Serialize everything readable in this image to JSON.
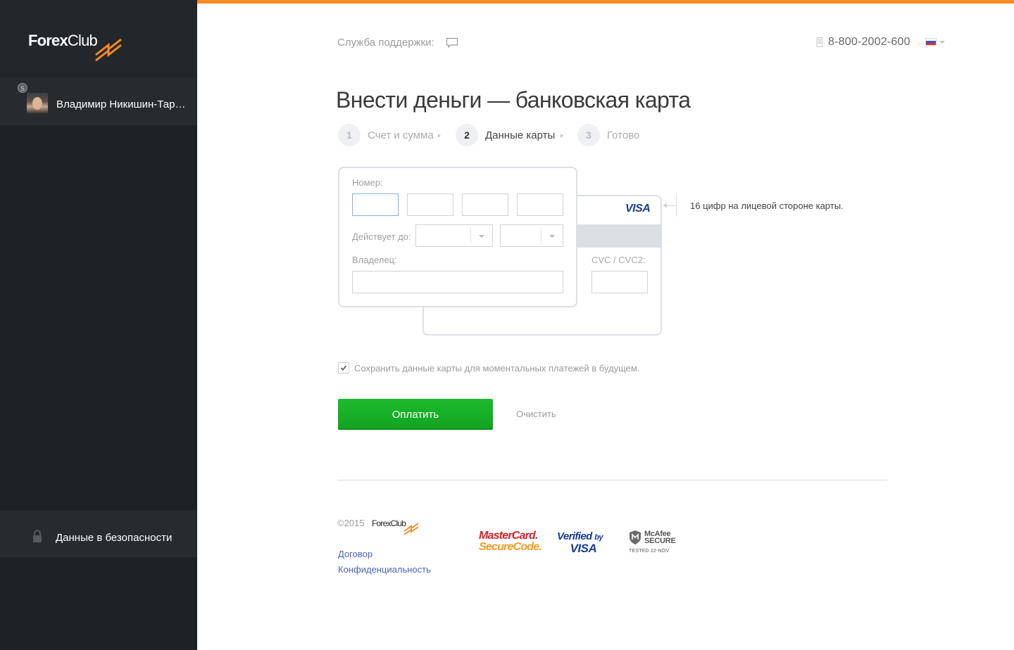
{
  "sidebar": {
    "logo": {
      "part1": "Forex",
      "part2": "Club"
    },
    "user": {
      "badge": "S",
      "name": "Владимир Никишин-Тарасов"
    },
    "secure_label": "Данные в безопасности"
  },
  "header": {
    "support_label": "Служба поддержки:",
    "phone": "8-800-2002-600",
    "language": "RU"
  },
  "page": {
    "title": "Внести деньги — банковская карта",
    "steps": [
      {
        "num": "1",
        "label": "Счет и сумма",
        "active": false
      },
      {
        "num": "2",
        "label": "Данные карты",
        "active": true
      },
      {
        "num": "3",
        "label": "Готово",
        "active": false
      }
    ]
  },
  "card_form": {
    "number_label": "Номер:",
    "expiry_label": "Действует до:",
    "owner_label": "Владелец:",
    "cvc_label": "CVC / CVC2:",
    "card_brand": "VISA",
    "number_hint": "16 цифр на лицевой стороне карты."
  },
  "save_card": {
    "label": "Сохранить данные карты для моментальных платежей в будущем.",
    "checked": true
  },
  "actions": {
    "pay_label": "Оплатить",
    "clear_label": "Очистить"
  },
  "footer": {
    "copyright": "©2015",
    "logo": "ForexClub",
    "links": [
      "Договор",
      "Конфиденциальность"
    ],
    "badges": {
      "mastercard": {
        "line1": "MasterCard.",
        "line2": "SecureCode."
      },
      "visa": {
        "line1": "Verified",
        "line1b": "by",
        "line2": "VISA"
      },
      "mcafee": {
        "line1": "McAfee",
        "line2": "SECURE",
        "line3": "TESTED 22-NOV"
      }
    }
  },
  "colors": {
    "accent": "#f7891f",
    "sidebar": "#1e2227",
    "pay_button": "#17ad27",
    "link": "#4a64b5"
  }
}
